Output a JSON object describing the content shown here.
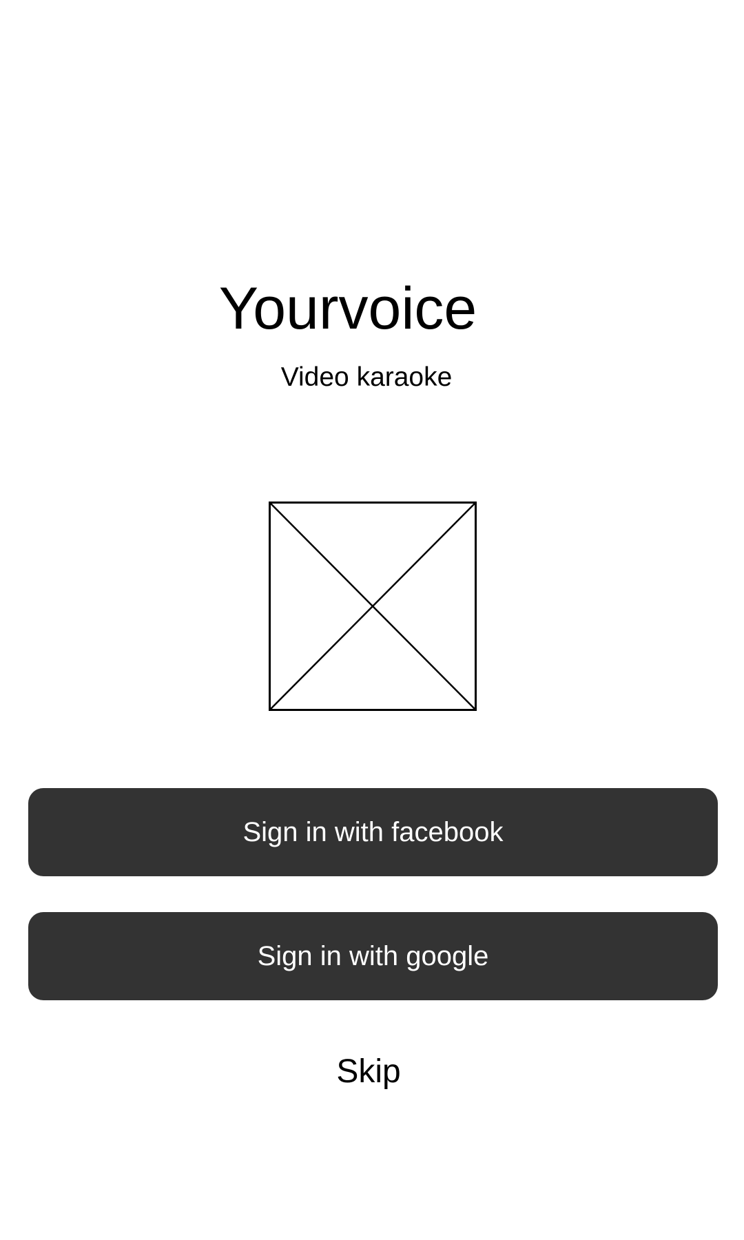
{
  "header": {
    "title": "Yourvoice",
    "subtitle": "Video karaoke"
  },
  "logo": {
    "icon": "image-placeholder-icon"
  },
  "actions": {
    "facebook_label": "Sign in with facebook",
    "google_label": "Sign in with google",
    "skip_label": "Skip"
  },
  "colors": {
    "background": "#ffffff",
    "button_background": "#333333",
    "button_text": "#ffffff",
    "text": "#000000"
  }
}
